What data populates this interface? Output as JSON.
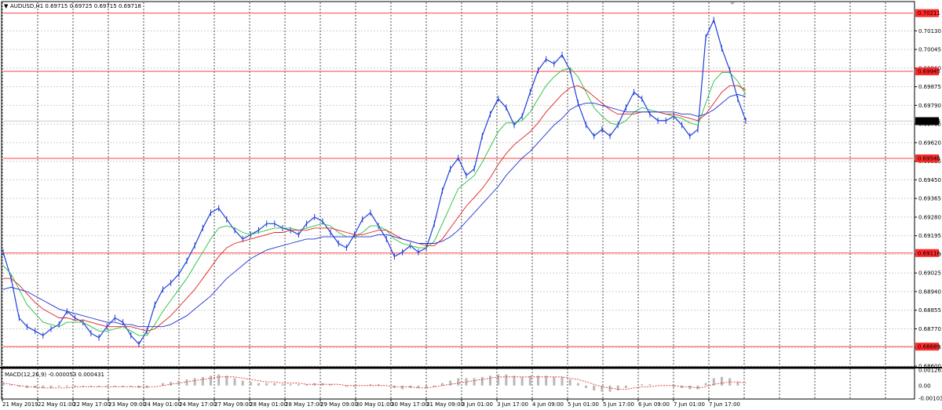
{
  "header": {
    "symbol_line": "AUDUSD,H1  0.69715 0.69725 0.69715 0.69718",
    "macd_label": "MACD(12,26,9) -0.000053 0.000431"
  },
  "colors": {
    "price_line": "#1f3fd8",
    "ma_fast": "#22c03a",
    "ma_mid": "#e02020",
    "ma_slow": "#2030d0",
    "level_line": "#ff4040",
    "level_tag_bg": "#ff2a2a",
    "current_tag_bg": "#000000",
    "grid": "#cfcfcf",
    "vgrid": "#000000",
    "macd_hist": "#b8b8b8",
    "macd_signal": "#e02020"
  },
  "price_axis": {
    "ticks": [
      "0.70130",
      "0.70045",
      "0.69960",
      "0.69875",
      "0.69790",
      "0.69705",
      "0.69620",
      "0.69535",
      "0.69450",
      "0.69365",
      "0.69280",
      "0.69195",
      "0.69110",
      "0.69025",
      "0.68940",
      "0.68855",
      "0.68770",
      "0.68685",
      "0.68600"
    ]
  },
  "macd_axis": {
    "ticks": [
      "0.001262",
      "0.00",
      "-0.001032"
    ]
  },
  "levels": [
    {
      "value": "0.70211"
    },
    {
      "value": "0.69945"
    },
    {
      "value": "0.69548"
    },
    {
      "value": "0.69116"
    },
    {
      "value": "0.68689"
    }
  ],
  "current_price": {
    "value": "0.69718"
  },
  "time_axis": {
    "labels": [
      "21 May 2019",
      "22 May 01:00",
      "22 May 17:00",
      "23 May 09:00",
      "24 May 01:00",
      "24 May 17:00",
      "27 May 09:00",
      "28 May 01:00",
      "28 May 17:00",
      "29 May 09:00",
      "30 May 01:00",
      "30 May 17:00",
      "31 May 09:00",
      "3 Jun 01:00",
      "3 Jun 17:00",
      "4 Jun 09:00",
      "5 Jun 01:00",
      "5 Jun 17:00",
      "6 Jun 09:00",
      "7 Jun 01:00",
      "7 Jun 17:00"
    ]
  },
  "chart_data": {
    "type": "line",
    "title": "AUDUSD,H1",
    "ylim": [
      0.686,
      0.7026
    ],
    "series": [
      {
        "values": [
          0.6912,
          0.69,
          0.6882,
          0.6878,
          0.6876,
          0.6874,
          0.6877,
          0.6879,
          0.6885,
          0.6882,
          0.688,
          0.6875,
          0.6873,
          0.6878,
          0.6882,
          0.688,
          0.6874,
          0.687,
          0.6876,
          0.6888,
          0.6895,
          0.6898,
          0.6902,
          0.6908,
          0.6915,
          0.6923,
          0.693,
          0.6932,
          0.6927,
          0.6922,
          0.6918,
          0.692,
          0.6922,
          0.6925,
          0.6925,
          0.6923,
          0.6922,
          0.692,
          0.6925,
          0.6928,
          0.6926,
          0.6921,
          0.6916,
          0.6914,
          0.692,
          0.6927,
          0.693,
          0.6924,
          0.6918,
          0.691,
          0.6912,
          0.6915,
          0.6912,
          0.6914,
          0.6925,
          0.694,
          0.695,
          0.6955,
          0.6947,
          0.695,
          0.6965,
          0.6975,
          0.6982,
          0.6978,
          0.697,
          0.6974,
          0.6985,
          0.6995,
          0.7,
          0.6998,
          0.7002,
          0.6995,
          0.698,
          0.697,
          0.6965,
          0.6968,
          0.6965,
          0.697,
          0.6978,
          0.6985,
          0.6982,
          0.6975,
          0.6972,
          0.6972,
          0.6974,
          0.697,
          0.6965,
          0.6968,
          0.701,
          0.7018,
          0.7005,
          0.6995,
          0.6982,
          0.6972
        ]
      },
      {
        "values": [
          0.6906,
          0.6902,
          0.6895,
          0.6888,
          0.6884,
          0.688,
          0.6879,
          0.6878,
          0.688,
          0.688,
          0.688,
          0.6878,
          0.6876,
          0.6876,
          0.6877,
          0.6878,
          0.6876,
          0.6874,
          0.6874,
          0.6879,
          0.6885,
          0.689,
          0.6895,
          0.69,
          0.6906,
          0.6912,
          0.6918,
          0.6923,
          0.6924,
          0.6923,
          0.6921,
          0.692,
          0.6921,
          0.6922,
          0.6923,
          0.6923,
          0.6923,
          0.6922,
          0.6923,
          0.6924,
          0.6925,
          0.6924,
          0.6921,
          0.6919,
          0.6919,
          0.6921,
          0.6924,
          0.6924,
          0.6922,
          0.6918,
          0.6916,
          0.6915,
          0.6914,
          0.6914,
          0.6917,
          0.6925,
          0.6933,
          0.6941,
          0.6944,
          0.6947,
          0.6953,
          0.696,
          0.6967,
          0.6971,
          0.6971,
          0.6972,
          0.6976,
          0.6982,
          0.6988,
          0.6992,
          0.6995,
          0.6996,
          0.6992,
          0.6985,
          0.6978,
          0.6974,
          0.6971,
          0.697,
          0.6972,
          0.6976,
          0.6978,
          0.6977,
          0.6976,
          0.6975,
          0.6974,
          0.6973,
          0.6971,
          0.697,
          0.698,
          0.699,
          0.6994,
          0.6994,
          0.699,
          0.6984
        ]
      },
      {
        "values": [
          0.69,
          0.69,
          0.6897,
          0.6893,
          0.6889,
          0.6886,
          0.6884,
          0.6882,
          0.6882,
          0.6881,
          0.6881,
          0.688,
          0.6879,
          0.6878,
          0.6878,
          0.6878,
          0.6878,
          0.6877,
          0.6876,
          0.6877,
          0.688,
          0.6883,
          0.6887,
          0.6891,
          0.6895,
          0.69,
          0.6905,
          0.691,
          0.6914,
          0.6916,
          0.6917,
          0.6918,
          0.6919,
          0.692,
          0.6921,
          0.6921,
          0.6922,
          0.6922,
          0.6922,
          0.6923,
          0.6923,
          0.6923,
          0.6922,
          0.6921,
          0.692,
          0.692,
          0.6921,
          0.6922,
          0.6922,
          0.692,
          0.6918,
          0.6917,
          0.6916,
          0.6915,
          0.6915,
          0.6918,
          0.6923,
          0.6928,
          0.6933,
          0.6937,
          0.6941,
          0.6946,
          0.6952,
          0.6957,
          0.6961,
          0.6964,
          0.6967,
          0.6971,
          0.6976,
          0.698,
          0.6984,
          0.6987,
          0.6988,
          0.6986,
          0.6983,
          0.698,
          0.6977,
          0.6975,
          0.6975,
          0.6975,
          0.6976,
          0.6976,
          0.6976,
          0.6975,
          0.6975,
          0.6974,
          0.6973,
          0.6972,
          0.6975,
          0.698,
          0.6985,
          0.6988,
          0.6988,
          0.6986
        ]
      },
      {
        "values": [
          0.6895,
          0.6896,
          0.6895,
          0.6894,
          0.6892,
          0.689,
          0.6888,
          0.6886,
          0.6885,
          0.6884,
          0.6883,
          0.6882,
          0.6881,
          0.688,
          0.688,
          0.6879,
          0.6879,
          0.6878,
          0.6878,
          0.6878,
          0.6878,
          0.6879,
          0.6881,
          0.6883,
          0.6886,
          0.6889,
          0.6892,
          0.6896,
          0.69,
          0.6903,
          0.6906,
          0.6909,
          0.6911,
          0.6913,
          0.6914,
          0.6915,
          0.6916,
          0.6917,
          0.6918,
          0.6918,
          0.6919,
          0.6919,
          0.6919,
          0.6919,
          0.6919,
          0.6919,
          0.6919,
          0.692,
          0.692,
          0.6919,
          0.6918,
          0.6917,
          0.6916,
          0.6916,
          0.6916,
          0.6917,
          0.6919,
          0.6922,
          0.6926,
          0.693,
          0.6934,
          0.6938,
          0.6942,
          0.6947,
          0.6951,
          0.6955,
          0.6958,
          0.6962,
          0.6966,
          0.697,
          0.6973,
          0.6977,
          0.6979,
          0.698,
          0.698,
          0.6979,
          0.6978,
          0.6977,
          0.6976,
          0.6976,
          0.6976,
          0.6976,
          0.6976,
          0.6976,
          0.6976,
          0.6975,
          0.6975,
          0.6974,
          0.6975,
          0.6977,
          0.698,
          0.6983,
          0.6984,
          0.6983
        ]
      }
    ],
    "macd": {
      "hist": [
        0.0002,
        0.0001,
        -0.0001,
        -0.0002,
        -0.0002,
        -0.0002,
        -0.0002,
        -0.0001,
        -0.0001,
        -0.0001,
        -0.0001,
        -0.0001,
        -0.0001,
        -0.0001,
        -0.0001,
        -0.0001,
        -0.0001,
        -0.0002,
        -0.0002,
        0.0,
        0.0002,
        0.0003,
        0.0004,
        0.0005,
        0.0006,
        0.0007,
        0.0008,
        0.0009,
        0.0008,
        0.0006,
        0.0004,
        0.0003,
        0.0002,
        0.0002,
        0.0002,
        0.0001,
        0.0001,
        0.0001,
        0.0001,
        0.0002,
        0.0002,
        0.0001,
        0.0,
        -0.0001,
        -0.0001,
        0.0,
        0.0001,
        0.0001,
        0.0,
        -0.0002,
        -0.0003,
        -0.0002,
        -0.0002,
        -0.0002,
        -0.0001,
        0.0002,
        0.0004,
        0.0006,
        0.0006,
        0.0006,
        0.0007,
        0.0008,
        0.0009,
        0.0009,
        0.0008,
        0.0007,
        0.0008,
        0.0008,
        0.0008,
        0.0007,
        0.0007,
        0.0005,
        0.0002,
        -0.0002,
        -0.0004,
        -0.0005,
        -0.0005,
        -0.0004,
        -0.0002,
        0.0,
        0.0001,
        0.0001,
        0.0,
        0.0,
        -0.0001,
        -0.0002,
        -0.0003,
        -0.0003,
        0.0002,
        0.0006,
        0.0007,
        0.0006,
        0.0003,
        0.0
      ],
      "signal": [
        0.0002,
        0.0001,
        0.0,
        -0.0001,
        -0.0001,
        -0.0002,
        -0.0002,
        -0.0002,
        -0.0002,
        -0.0001,
        -0.0001,
        -0.0001,
        -0.0001,
        -0.0001,
        -0.0001,
        -0.0001,
        -0.0001,
        -0.0001,
        -0.0001,
        -0.0001,
        0.0,
        0.0001,
        0.0002,
        0.0003,
        0.0004,
        0.0005,
        0.0006,
        0.0007,
        0.0007,
        0.0007,
        0.0006,
        0.0005,
        0.0004,
        0.0003,
        0.0003,
        0.0002,
        0.0002,
        0.0002,
        0.0001,
        0.0001,
        0.0001,
        0.0001,
        0.0001,
        0.0,
        0.0,
        0.0,
        0.0,
        0.0,
        0.0,
        -0.0001,
        -0.0001,
        -0.0001,
        -0.0002,
        -0.0002,
        -0.0001,
        0.0,
        0.0001,
        0.0002,
        0.0003,
        0.0004,
        0.0005,
        0.0006,
        0.0007,
        0.0007,
        0.0007,
        0.0007,
        0.0007,
        0.0007,
        0.0007,
        0.0007,
        0.0007,
        0.0006,
        0.0005,
        0.0003,
        0.0001,
        -0.0001,
        -0.0002,
        -0.0003,
        -0.0003,
        -0.0002,
        -0.0001,
        -0.0001,
        0.0,
        0.0,
        0.0,
        -0.0001,
        -0.0001,
        -0.0002,
        -0.0001,
        0.0001,
        0.0002,
        0.0003,
        0.0003,
        0.0002
      ],
      "ylim": [
        -0.001032,
        0.001262
      ]
    }
  }
}
